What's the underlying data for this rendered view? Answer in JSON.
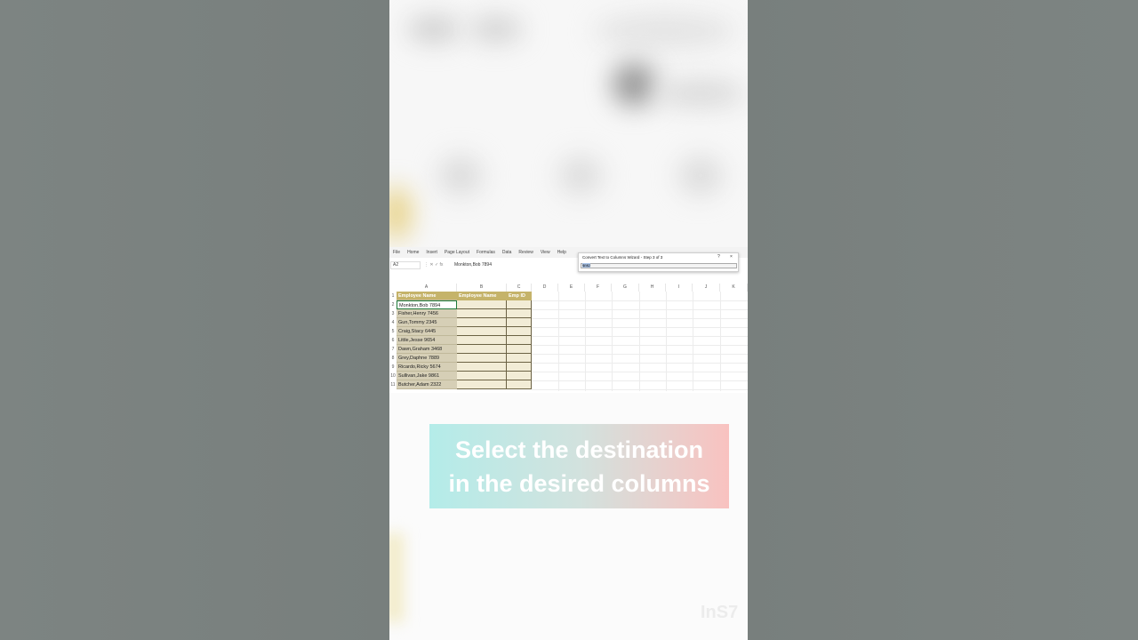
{
  "ribbon": {
    "tabs": [
      "File",
      "Home",
      "Insert",
      "Page Layout",
      "Formulas",
      "Data",
      "Review",
      "View",
      "Help"
    ]
  },
  "formula_bar": {
    "name_box": "A2",
    "fx_symbol": "fx",
    "value": "Monkton,Bob 7894"
  },
  "dialog": {
    "title": "Convert Text to Columns Wizard - Step 3 of 3",
    "help": "?",
    "close": "×",
    "destination_value": "$B$2"
  },
  "columns": [
    "A",
    "B",
    "C",
    "D",
    "E",
    "F",
    "G",
    "H",
    "I",
    "J",
    "K"
  ],
  "rows": [
    "1",
    "2",
    "3",
    "4",
    "5",
    "6",
    "7",
    "8",
    "9",
    "10",
    "11"
  ],
  "table": {
    "headers": [
      "Employee Name",
      "Employee Name",
      "Emp ID"
    ],
    "names": [
      "Monkton,Bob 7894",
      "Fisher,Henry 7456",
      "Gun,Tommy 2345",
      "Craig,Stacy 6445",
      "Little,Jesse 9654",
      "Dawn,Graham 3468",
      "Grey,Daphne 7889",
      "Ricardo,Ricky 5674",
      "Sullivan,Jake 9861",
      "Butcher,Adam 2322"
    ]
  },
  "caption": {
    "line1": "Select the destination",
    "line2": "in the desired columns"
  },
  "watermark": "InS7"
}
